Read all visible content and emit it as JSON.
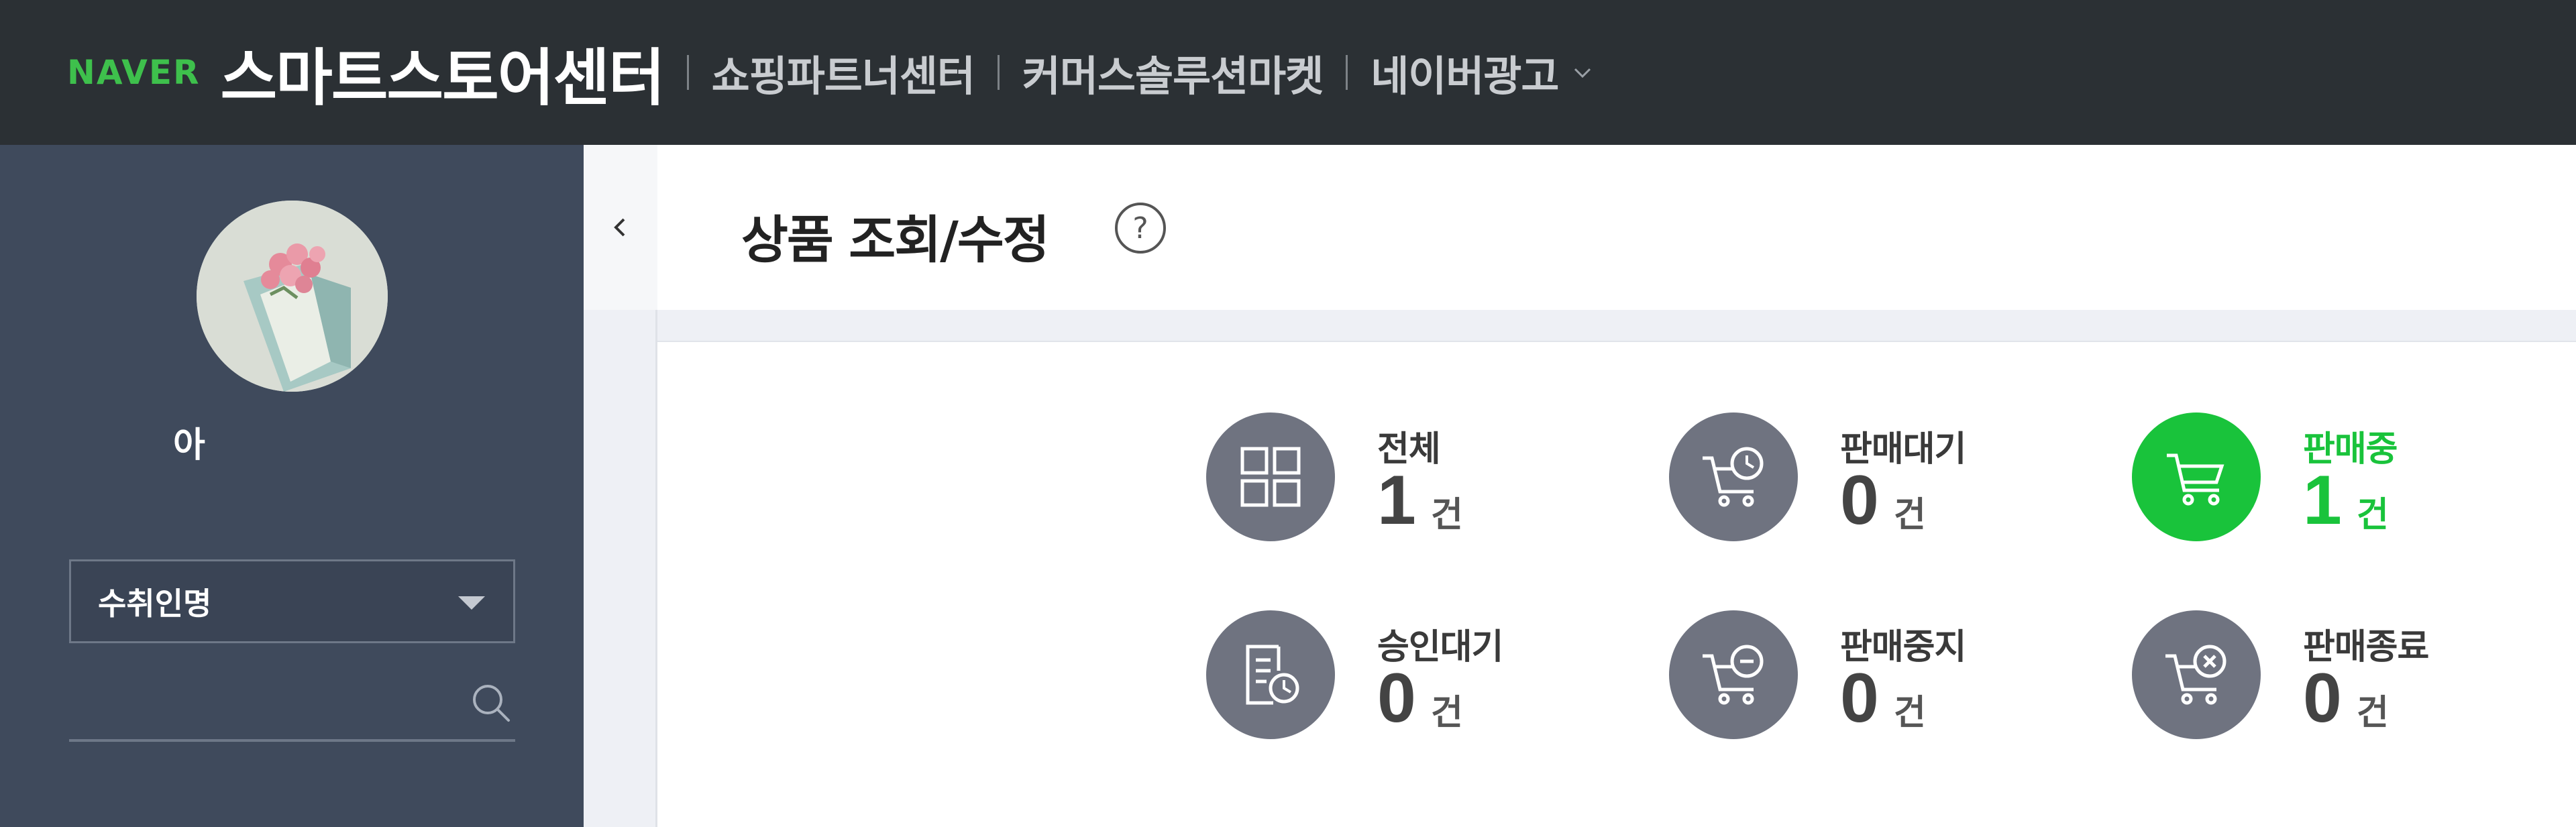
{
  "topbar": {
    "logo": "NAVER",
    "title": "스마트스토어센터",
    "links": [
      "쇼핑파트너센터",
      "커머스솔루션마켓",
      "네이버광고"
    ]
  },
  "sidebar": {
    "store_name": "아",
    "select": {
      "value": "수취인명"
    },
    "search": {
      "placeholder": ""
    }
  },
  "main": {
    "title": "상품 조회/수정",
    "stats": [
      {
        "label": "전체",
        "count": "1",
        "unit": "건",
        "icon": "grid-icon",
        "active": false
      },
      {
        "label": "판매대기",
        "count": "0",
        "unit": "건",
        "icon": "cart-clock-icon",
        "active": false
      },
      {
        "label": "판매중",
        "count": "1",
        "unit": "건",
        "icon": "cart-icon",
        "active": true
      },
      {
        "label": "승인대기",
        "count": "0",
        "unit": "건",
        "icon": "document-clock-icon",
        "active": false
      },
      {
        "label": "판매중지",
        "count": "0",
        "unit": "건",
        "icon": "cart-minus-icon",
        "active": false
      },
      {
        "label": "판매종료",
        "count": "0",
        "unit": "건",
        "icon": "cart-x-icon",
        "active": false
      }
    ]
  },
  "colors": {
    "topbar_bg": "#2b3034",
    "sidebar_bg": "#3f4a5c",
    "naver_green": "#3ec04c",
    "active_green": "#19c33b",
    "icon_gray": "#6f7380"
  }
}
